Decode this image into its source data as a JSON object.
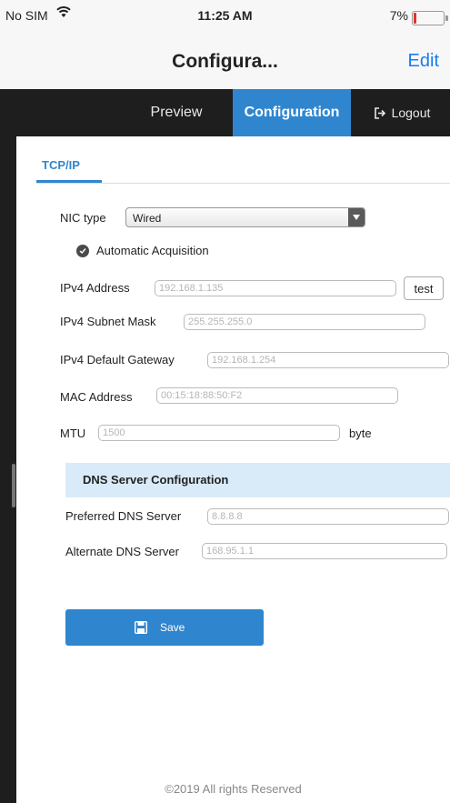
{
  "status_bar": {
    "carrier": "No SIM",
    "time": "11:25 AM",
    "battery": "7%",
    "battery_level": 0.07,
    "battery_color": "#e0322d"
  },
  "nav_bar": {
    "title": "Configura...",
    "edit_label": "Edit"
  },
  "menu": {
    "preview": "Preview",
    "configuration": "Configuration",
    "logout": "Logout",
    "active_color": "#2f86cf"
  },
  "tab": {
    "label": "TCP/IP"
  },
  "form": {
    "nic_type_label": "NIC type",
    "nic_type_value": "Wired",
    "auto_acquisition_label": "Automatic Acquisition",
    "ipv4_address_label": "IPv4 Address",
    "ipv4_address_placeholder": "192.168.1.135",
    "test_label": "test",
    "subnet_mask_label": "IPv4 Subnet Mask",
    "subnet_mask_placeholder": "255.255.255.0",
    "gateway_label": "IPv4 Default Gateway",
    "gateway_placeholder": "192.168.1.254",
    "mac_label": "MAC Address",
    "mac_placeholder": "00:15:18:88:50:F2",
    "mtu_label": "MTU",
    "mtu_placeholder": "1500",
    "mtu_unit": "byte"
  },
  "dns": {
    "header": "DNS Server Configuration",
    "preferred_label": "Preferred DNS Server",
    "preferred_placeholder": "8.8.8.8",
    "alternate_label": "Alternate DNS Server",
    "alternate_placeholder": "168.95.1.1"
  },
  "save_label": "Save",
  "footer": "©2019 All rights Reserved"
}
